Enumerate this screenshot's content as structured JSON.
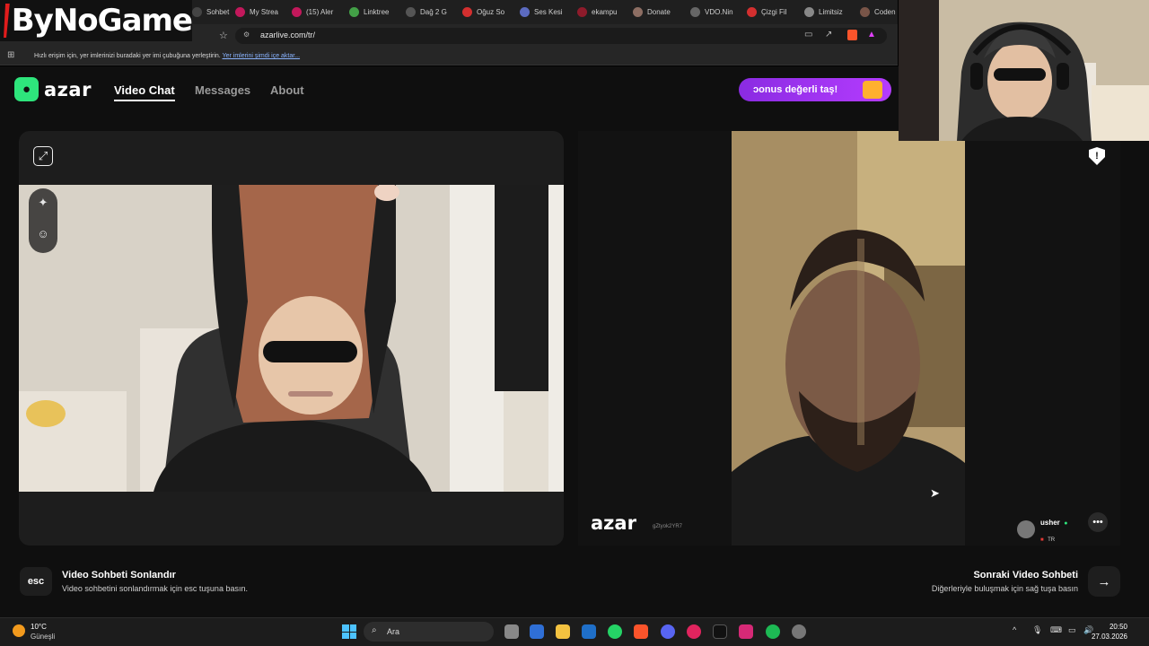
{
  "channel_logo": {
    "text": "ByNoGame"
  },
  "browser": {
    "tabs": [
      {
        "label": "Sohbet",
        "icon": "tab-icon",
        "color": "#444444"
      },
      {
        "label": "My Strea",
        "icon": "streamlabs-icon",
        "color": "#c2185b"
      },
      {
        "label": "(15) Aler",
        "icon": "alert-icon",
        "color": "#c2185b"
      },
      {
        "label": "Linktree",
        "icon": "linktree-icon",
        "color": "#43a047"
      },
      {
        "label": "Dağ 2 G",
        "icon": "game-icon",
        "color": "#555555"
      },
      {
        "label": "Oğuz So",
        "icon": "youtube-icon",
        "color": "#d32f2f"
      },
      {
        "label": "Ses Kesi",
        "icon": "voice-icon",
        "color": "#5c6bc0"
      },
      {
        "label": "ekampu",
        "icon": "kampus-icon",
        "color": "#8e1b2b"
      },
      {
        "label": "Donate",
        "icon": "donate-icon",
        "color": "#8d6e63"
      },
      {
        "label": "VDO.Nin",
        "icon": "vdo-icon",
        "color": "#666666"
      },
      {
        "label": "Çizgi Fil",
        "icon": "cartoon-icon",
        "color": "#d32f2f"
      },
      {
        "label": "Limitsiz",
        "icon": "limitless-icon",
        "color": "#888888"
      },
      {
        "label": "Codena",
        "icon": "codename-icon",
        "color": "#795548"
      }
    ],
    "url": "azarlive.com/tr/",
    "bookmarks_bar_text": "Hızlı erişim için, yer imlerinizi buradaki yer imi çubuğuna yerleştirin.",
    "bookmarks_bar_link": "Yer imlerini şimdi içe aktar..."
  },
  "header": {
    "logo_text": "azar",
    "nav": {
      "video_chat": "Video Chat",
      "messages": "Messages",
      "about": "About"
    },
    "promo_text": "ɔonus değerli taş!"
  },
  "peer": {
    "watermark": "azar",
    "code": "gZtyok2YR7",
    "name": "usher",
    "country": "TR"
  },
  "footer": {
    "esc_key": "esc",
    "end_title": "Video Sohbeti Sonlandır",
    "end_desc": "Video sohbetini sonlandırmak için esc tuşuna basın.",
    "next_title": "Sonraki Video Sohbeti",
    "next_desc": "Diğerleriyle buluşmak için sağ tuşa basın"
  },
  "taskbar": {
    "weather_temp": "10°C",
    "weather_desc": "Güneşli",
    "search_label": "Ara",
    "time": "20:50",
    "date": "27.03.2026"
  },
  "colors": {
    "accent_green": "#2ee57c",
    "promo_purple": "#8a2be2"
  }
}
